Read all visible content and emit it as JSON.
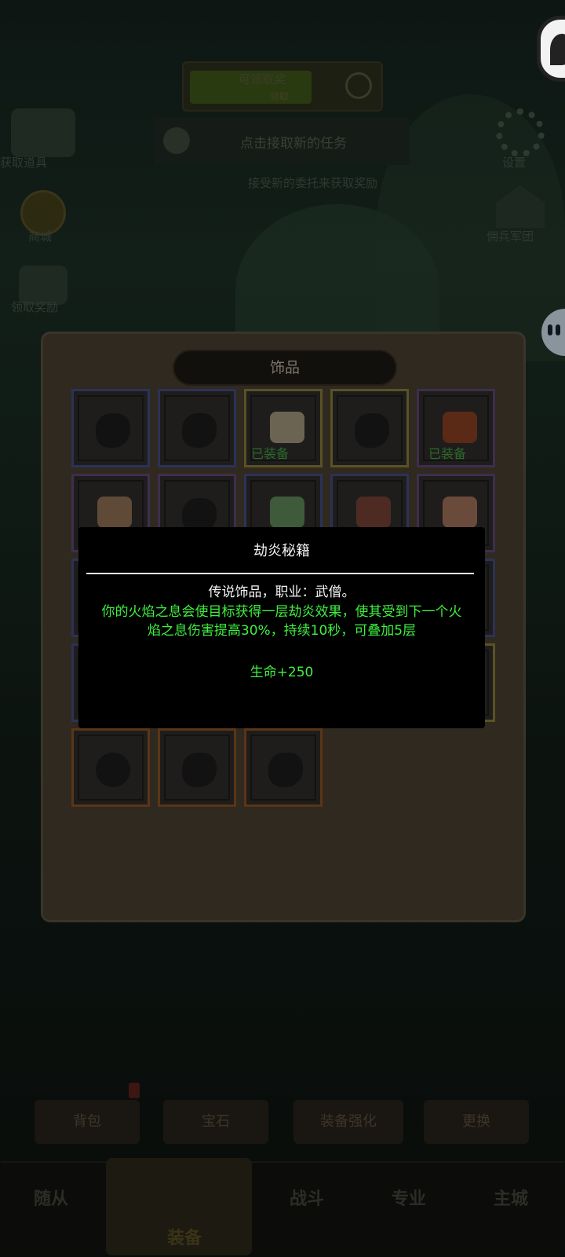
{
  "background": {
    "banner_title": "可领取奖",
    "banner_sub": "领取",
    "task_button": "点击接取新的任务",
    "info_line": "接受新的委托来获取奖励",
    "left_labels": [
      "获取道具",
      "商城",
      "领取奖励"
    ],
    "right_labels": [
      "设置",
      "佣兵军团"
    ],
    "action_tabs": [
      "背包",
      "宝石",
      "装备强化",
      "更换"
    ],
    "nav_items": [
      "随从",
      "装备",
      "战斗",
      "专业",
      "主城"
    ]
  },
  "panel": {
    "title": "饰品",
    "equipped_label": "已装备",
    "slots": [
      {
        "quality": "blue",
        "equipped": false,
        "icon": "empty-slot-icon"
      },
      {
        "quality": "blue",
        "equipped": false,
        "icon": "empty-slot-icon"
      },
      {
        "quality": "gold",
        "equipped": true,
        "icon": "scroll-icon"
      },
      {
        "quality": "gold",
        "equipped": false,
        "icon": "empty-slot-icon"
      },
      {
        "quality": "purple",
        "equipped": true,
        "icon": "gauntlet-icon"
      },
      {
        "quality": "purple",
        "equipped": false,
        "icon": "scroll-icon"
      },
      {
        "quality": "purple",
        "equipped": false,
        "icon": "empty-slot-icon"
      },
      {
        "quality": "blue",
        "equipped": false,
        "icon": "amulet-icon"
      },
      {
        "quality": "blue",
        "equipped": false,
        "icon": "book-icon"
      },
      {
        "quality": "purple",
        "equipped": false,
        "icon": "scroll-icon"
      }
    ]
  },
  "tooltip": {
    "name": "劫炎秘籍",
    "type_line": "传说饰品，职业：武僧。",
    "description": "你的火焰之息会使目标获得一层劫炎效果，使其受到下一个火焰之息伤害提高30%，持续10秒，可叠加5层",
    "stat": "生命+250"
  },
  "colors": {
    "tooltip_text_green": "#3ff03f",
    "equipped_green": "#2c6a2b"
  }
}
